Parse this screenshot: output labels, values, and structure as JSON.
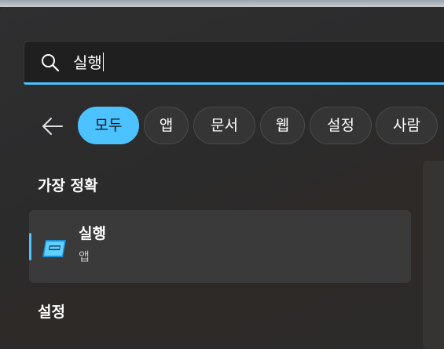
{
  "search": {
    "query": "실행"
  },
  "filters": [
    {
      "label": "모두",
      "active": true
    },
    {
      "label": "앱",
      "active": false
    },
    {
      "label": "문서",
      "active": false
    },
    {
      "label": "웹",
      "active": false
    },
    {
      "label": "설정",
      "active": false
    },
    {
      "label": "사람",
      "active": false
    }
  ],
  "best_match": {
    "heading": "가장 정확",
    "item": {
      "title": "실행",
      "subtitle": "앱",
      "icon": "run-app-icon"
    }
  },
  "settings": {
    "heading": "설정"
  },
  "colors": {
    "accent": "#4cc2ff",
    "panel": "#2b2b2b",
    "card": "#3a3a3a"
  }
}
